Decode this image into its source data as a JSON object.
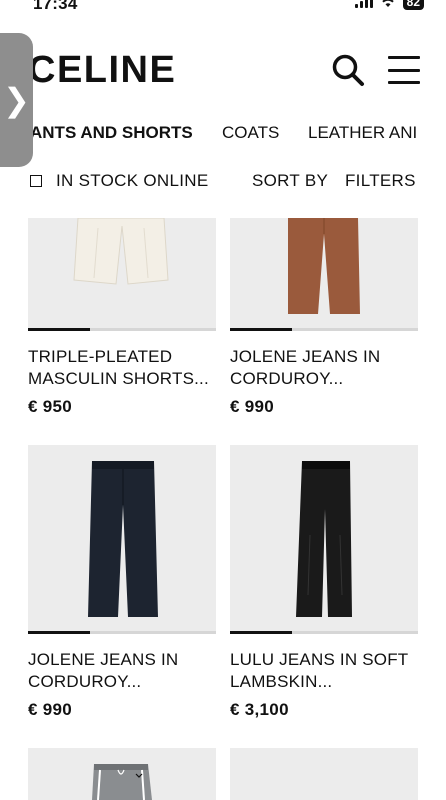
{
  "status": {
    "time": "17:34",
    "battery": "82"
  },
  "header": {
    "logo": "CELINE"
  },
  "side_tab": {
    "glyph": "❯"
  },
  "categories": [
    {
      "label": "ANTS AND SHORTS",
      "active": true
    },
    {
      "label": "COATS",
      "active": false
    },
    {
      "label": "LEATHER ANI",
      "active": false
    }
  ],
  "filters": {
    "stock_label": "IN STOCK ONLINE",
    "sort_label": "SORT BY",
    "filters_label": "FILTERS"
  },
  "products": [
    {
      "name_line1": "TRIPLE-PLEATED",
      "name_line2": "MASCULIN SHORTS...",
      "price": "€ 950",
      "image": "cream-shorts",
      "color": "#f1ede4",
      "carousel_progress": 0.33
    },
    {
      "name_line1": "JOLENE JEANS IN",
      "name_line2": "CORDUROY...",
      "price": "€ 990",
      "image": "brown-corduroy-jeans",
      "color": "#9a5a3c",
      "carousel_progress": 0.33
    },
    {
      "name_line1": "JOLENE JEANS IN",
      "name_line2": "CORDUROY...",
      "price": "€ 990",
      "image": "navy-corduroy-jeans",
      "color": "#1d2430",
      "carousel_progress": 0.33
    },
    {
      "name_line1": "LULU JEANS IN SOFT",
      "name_line2": "LAMBSKIN...",
      "price": "€ 3,100",
      "image": "black-leather-jeans",
      "color": "#1a1a1a",
      "carousel_progress": 0.33
    },
    {
      "name_line1": "",
      "name_line2": "",
      "price": "",
      "image": "grey-track-pants",
      "color": "#8a8d90",
      "carousel_progress": 0
    },
    {
      "name_line1": "",
      "name_line2": "",
      "price": "",
      "image": "empty",
      "color": "#ececec",
      "carousel_progress": 0
    }
  ]
}
